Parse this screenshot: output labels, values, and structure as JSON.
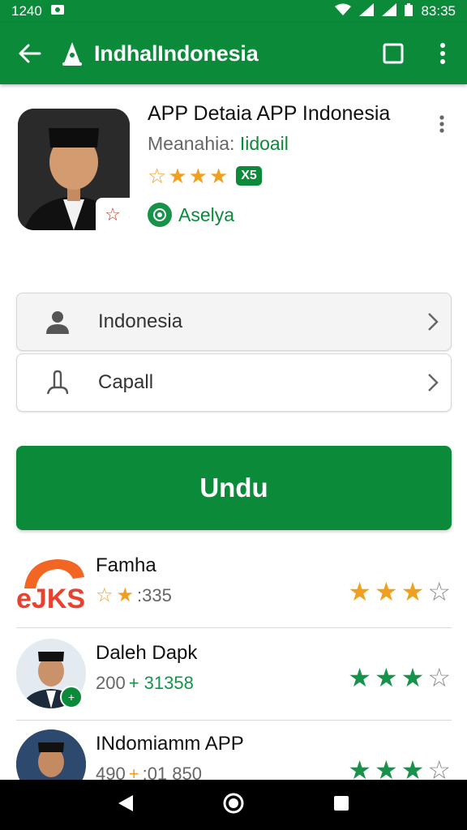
{
  "status_bar": {
    "time": "1240",
    "clock": "83:35"
  },
  "app_bar": {
    "title": "IndhalIndonesia",
    "icons": [
      "back-arrow-icon",
      "app-logo-icon",
      "square-icon",
      "more-vert-icon"
    ]
  },
  "header": {
    "title": "APP Detaia APP Indonesia",
    "subtitle_prefix": "Meanahia:",
    "subtitle_value": "Iidoail",
    "rating_stars": 4,
    "badge": "X5",
    "verified_label": "Aselya"
  },
  "rows": [
    {
      "label": "Indonesia",
      "icon": "person-icon"
    },
    {
      "label": "Capall",
      "icon": "touch-icon"
    }
  ],
  "install_button": {
    "label": "Undu"
  },
  "list": [
    {
      "name": "Famha",
      "meta": ":335",
      "meta_accent": "",
      "rating": 3,
      "star_color": "gold",
      "avatar": "logo-avatar"
    },
    {
      "name": "Daleh Dapk",
      "meta": "200",
      "meta_accent": "+ 31358",
      "rating": 3,
      "star_color": "green",
      "avatar": "person-avatar"
    },
    {
      "name": "INdomiamm APP",
      "meta": "490",
      "meta_accent": ":01 850",
      "rating": 3,
      "star_color": "green",
      "avatar": "person-avatar"
    }
  ],
  "colors": {
    "brand": "#0b8a3a",
    "star_gold": "#f0a01e",
    "star_green": "#16924b"
  }
}
